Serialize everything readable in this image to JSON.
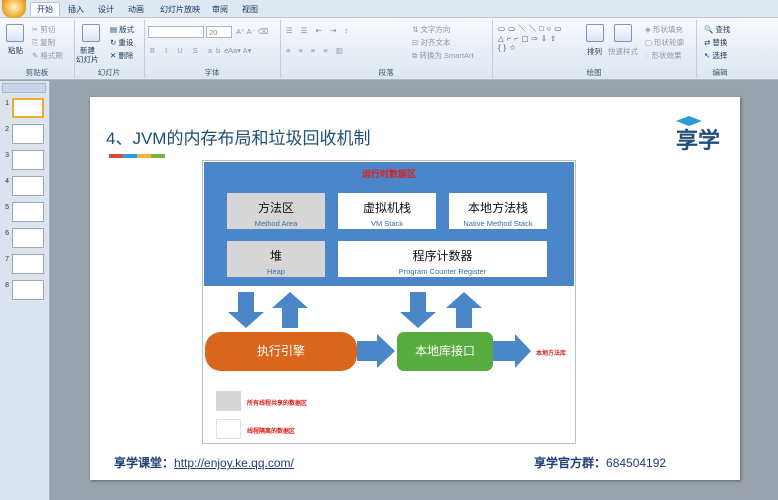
{
  "ribbon": {
    "tabs": [
      "开始",
      "插入",
      "设计",
      "动画",
      "幻灯片放映",
      "审阅",
      "视图"
    ],
    "active_tab": "开始",
    "clipboard": {
      "paste": "粘贴",
      "cut": "剪切",
      "copy": "复制",
      "format_painter": "格式刷",
      "label": "剪贴板"
    },
    "slides": {
      "new_slide": "新建",
      "new_slide2": "幻灯片",
      "layout": "版式",
      "reset": "重设",
      "delete": "删除",
      "label": "幻灯片"
    },
    "font": {
      "size": "20",
      "label": "字体"
    },
    "paragraph": {
      "text_direction": "文字方向",
      "align_text": "对齐文本",
      "smartart": "转换为 SmartArt",
      "label": "段落"
    },
    "drawing": {
      "arrange": "排列",
      "quick_styles": "快速样式",
      "shape_fill": "形状填充",
      "shape_outline": "形状轮廓",
      "shape_effects": "形状效果",
      "label": "绘图"
    },
    "editing": {
      "find": "查找",
      "replace": "替换",
      "select": "选择",
      "label": "编辑"
    }
  },
  "slide_panel": {
    "numbers": [
      "1",
      "2",
      "3",
      "4",
      "5",
      "6",
      "7",
      "8"
    ],
    "selected": 1
  },
  "slide": {
    "title": "4、JVM的内存布局和垃圾回收机制",
    "title_bar_colors": [
      "#d9483b",
      "#2f9bd6",
      "#f2b432",
      "#7cb342"
    ],
    "logo": "享学",
    "diagram": {
      "region_title": "运行时数据区",
      "method_area": {
        "main": "方法区",
        "sub": "Method Area"
      },
      "vm_stack": {
        "main": "虚拟机栈",
        "sub": "VM Stack"
      },
      "native_stack": {
        "main": "本地方法栈",
        "sub": "Native Method Stack"
      },
      "heap": {
        "main": "堆",
        "sub": "Heap"
      },
      "pc_register": {
        "main": "程序计数器",
        "sub": "Program Counter Register"
      },
      "engine": "执行引擎",
      "native_interface": "本地库接口",
      "native_library": "本地方法库",
      "legend_shared": "所有线程共享的数据区",
      "legend_isolated": "线程隔离的数据区"
    },
    "footer": {
      "course_label": "享学课堂：",
      "course_url": "http://enjoy.ke.qq.com/",
      "group_label": "享学官方群：",
      "group_number": "684504192"
    }
  }
}
